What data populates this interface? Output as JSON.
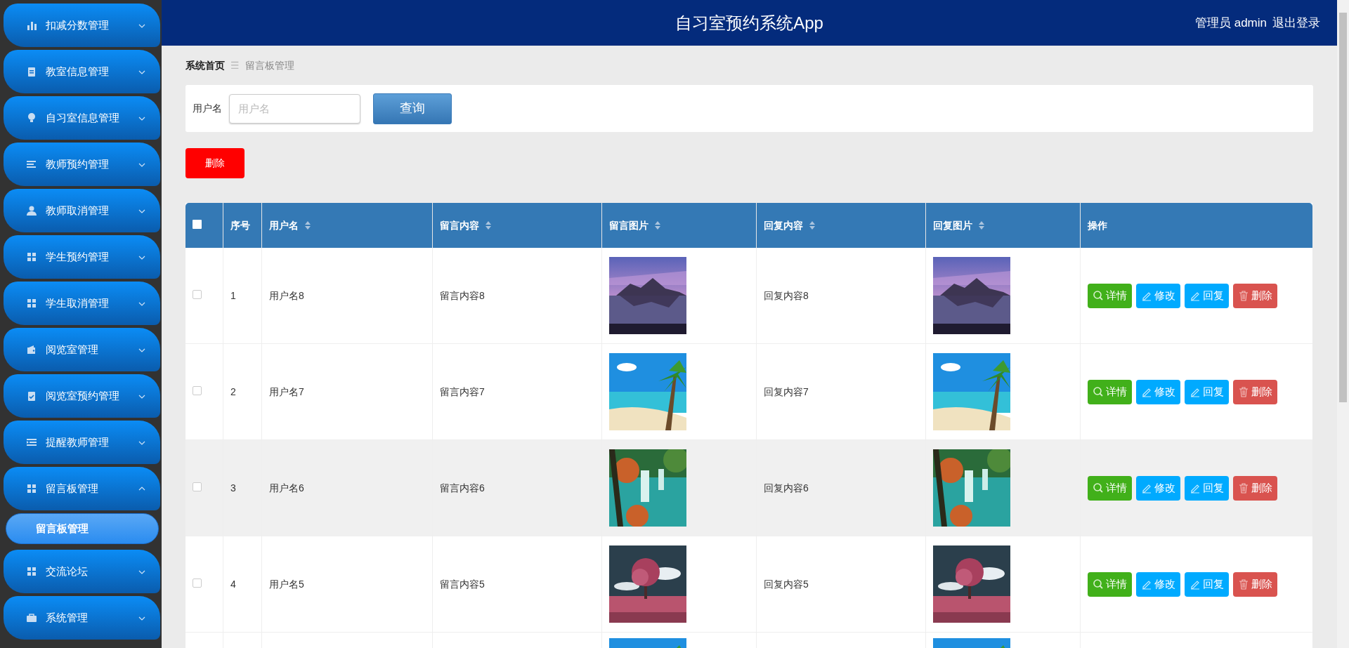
{
  "sidebar": {
    "items": [
      {
        "label": "扣减分数管理",
        "expanded": false
      },
      {
        "label": "教室信息管理",
        "expanded": false
      },
      {
        "label": "自习室信息管理",
        "expanded": false
      },
      {
        "label": "教师预约管理",
        "expanded": false
      },
      {
        "label": "教师取消管理",
        "expanded": false
      },
      {
        "label": "学生预约管理",
        "expanded": false
      },
      {
        "label": "学生取消管理",
        "expanded": false
      },
      {
        "label": "阅览室管理",
        "expanded": false
      },
      {
        "label": "阅览室预约管理",
        "expanded": false
      },
      {
        "label": "提醒教师管理",
        "expanded": false
      },
      {
        "label": "留言板管理",
        "expanded": true,
        "children": [
          {
            "label": "留言板管理",
            "selected": true
          }
        ]
      },
      {
        "label": "交流论坛",
        "expanded": false
      },
      {
        "label": "系统管理",
        "expanded": false
      }
    ]
  },
  "header": {
    "title": "自习室预约系统App",
    "user": "管理员 admin",
    "logout": "退出登录"
  },
  "breadcrumb": {
    "home": "系统首页",
    "separator": "☰",
    "current": "留言板管理"
  },
  "search": {
    "label": "用户名",
    "placeholder": "用户名",
    "button": "查询"
  },
  "delete_button": "删除",
  "table": {
    "select_all_checked": false,
    "columns": [
      {
        "label": "序号",
        "sortable": false
      },
      {
        "label": "用户名",
        "sortable": true
      },
      {
        "label": "留言内容",
        "sortable": true
      },
      {
        "label": "留言图片",
        "sortable": true
      },
      {
        "label": "回复内容",
        "sortable": true
      },
      {
        "label": "回复图片",
        "sortable": true
      },
      {
        "label": "操作",
        "sortable": false
      }
    ],
    "rows": [
      {
        "checked": false,
        "highlighted": false,
        "index": "1",
        "username": "用户名8",
        "message": "留言内容8",
        "reply": "回复内容8",
        "actions": [
          {
            "label": "详情",
            "kind": "detail"
          },
          {
            "label": "修改",
            "kind": "edit"
          },
          {
            "label": "回复",
            "kind": "reply"
          },
          {
            "label": "删除",
            "kind": "delete"
          }
        ]
      },
      {
        "checked": false,
        "highlighted": false,
        "index": "2",
        "username": "用户名7",
        "message": "留言内容7",
        "reply": "回复内容7",
        "actions": [
          {
            "label": "详情",
            "kind": "detail"
          },
          {
            "label": "修改",
            "kind": "edit"
          },
          {
            "label": "回复",
            "kind": "reply"
          },
          {
            "label": "删除",
            "kind": "delete"
          }
        ]
      },
      {
        "checked": false,
        "highlighted": true,
        "index": "3",
        "username": "用户名6",
        "message": "留言内容6",
        "reply": "回复内容6",
        "actions": [
          {
            "label": "详情",
            "kind": "detail"
          },
          {
            "label": "修改",
            "kind": "edit"
          },
          {
            "label": "回复",
            "kind": "reply"
          },
          {
            "label": "删除",
            "kind": "delete"
          }
        ]
      },
      {
        "checked": false,
        "highlighted": false,
        "index": "4",
        "username": "用户名5",
        "message": "留言内容5",
        "reply": "回复内容5",
        "actions": [
          {
            "label": "详情",
            "kind": "detail"
          },
          {
            "label": "修改",
            "kind": "edit"
          },
          {
            "label": "回复",
            "kind": "reply"
          },
          {
            "label": "删除",
            "kind": "delete"
          }
        ]
      },
      {
        "kind": "partial"
      }
    ]
  }
}
